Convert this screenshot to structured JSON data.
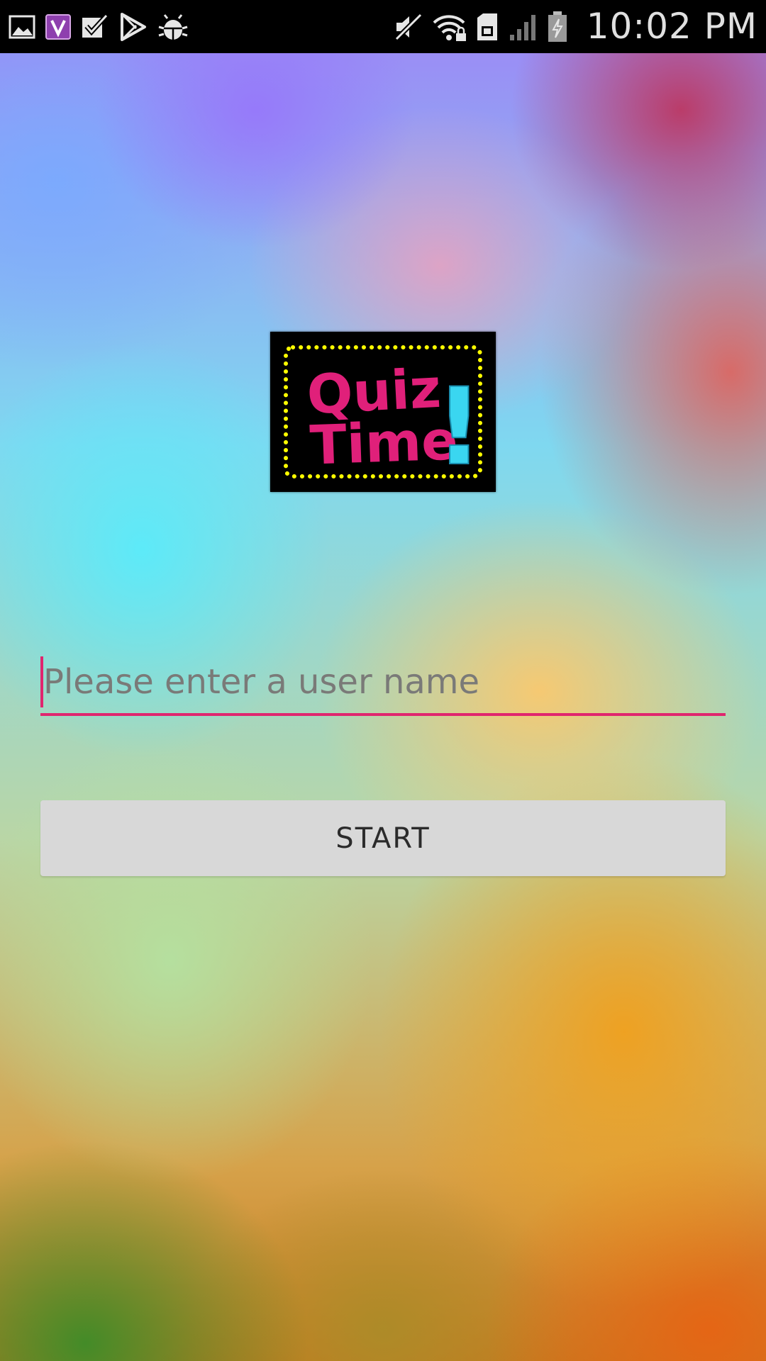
{
  "status_bar": {
    "time": "10:02 PM",
    "left_icons": [
      "gallery-icon",
      "viber-icon",
      "checkbox-icon",
      "play-store-icon",
      "android-bug-icon"
    ],
    "right_icons": [
      "mute-icon",
      "wifi-icon",
      "sim-card-icon",
      "signal-icon",
      "battery-charging-icon"
    ],
    "colors": {
      "background": "#000000",
      "text": "#e0e0e0"
    }
  },
  "logo": {
    "line1": "Quiz",
    "line2": "Time",
    "mark": "!",
    "colors": {
      "background": "#000000",
      "border_dots": "#ffff00",
      "text": "#e0207a",
      "exclamation": "#3ad6f0"
    }
  },
  "form": {
    "username_placeholder": "Please enter a user name",
    "username_value": "",
    "start_label": "START",
    "colors": {
      "accent": "#e0256e",
      "button_bg": "#d8d8d8",
      "button_text": "#2b2b2b"
    }
  }
}
